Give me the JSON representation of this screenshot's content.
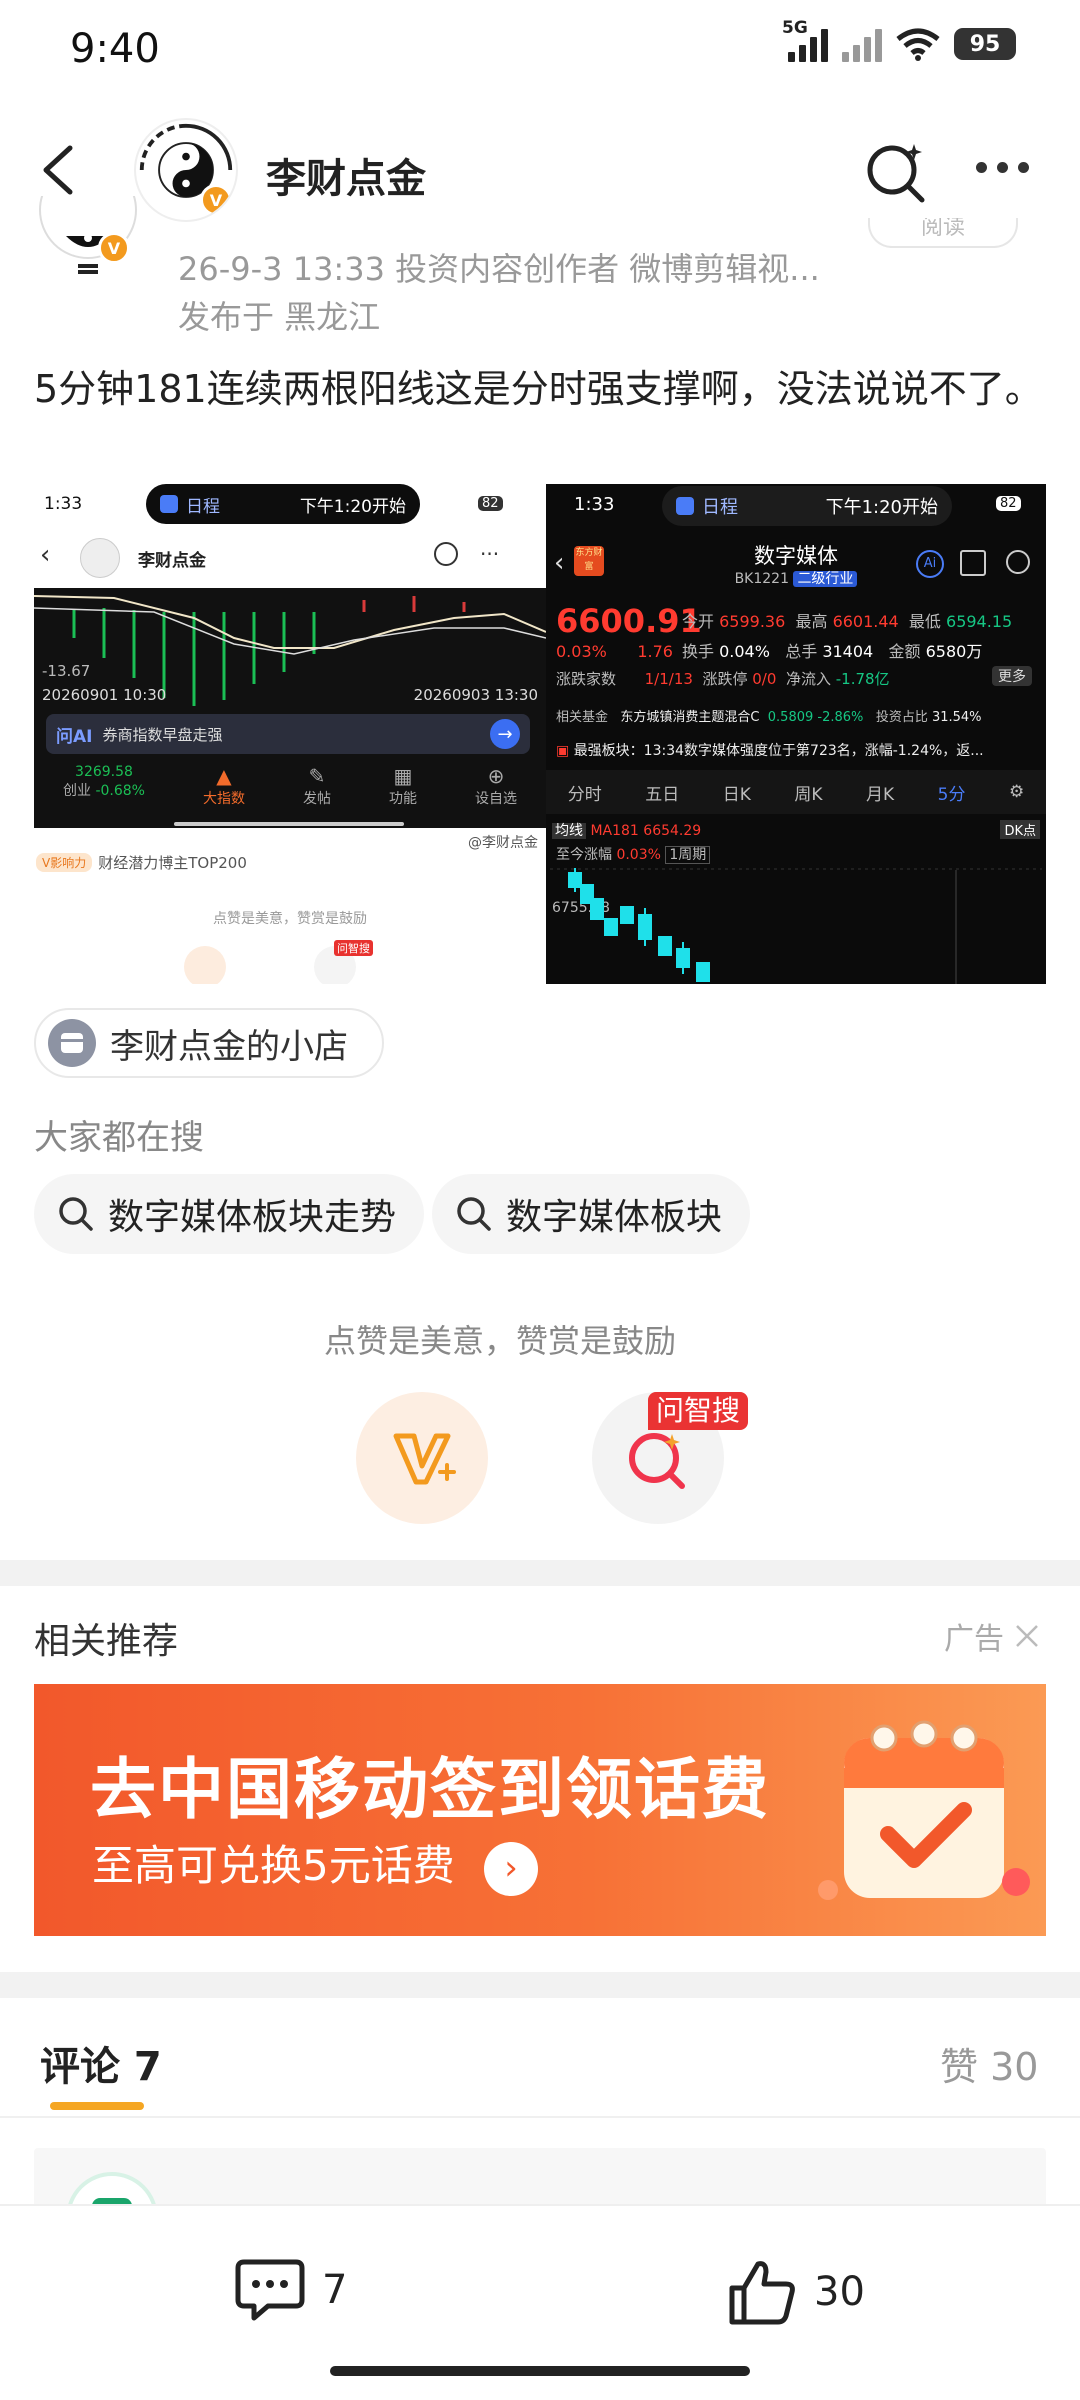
{
  "status_bar": {
    "time": "9:40",
    "network": "5G",
    "battery": "95"
  },
  "header": {
    "title": "李财点金"
  },
  "post": {
    "meta": "26-9-3 13:33   投资内容创作者 微博剪辑视...",
    "location": "发布于 黑龙江",
    "read_chip": "阅读",
    "text": "5分钟181连续两根阳线这是分时强支撑啊，没法说说不了。"
  },
  "image1": {
    "time": "1:33",
    "pill_app": "日程",
    "pill_text": "下午1:20开始",
    "wifi_level": "82",
    "nav_title": "李财点金",
    "chart_low": "-13.67",
    "date_left": "20260901 10:30",
    "date_right": "20260903 13:30",
    "ai_label": "问AI",
    "ai_text": "券商指数早盘走强",
    "tab_value": "3269.58",
    "tab1_label": "创业",
    "tab1_change": "-0.68%",
    "tab2_label": "大指数",
    "tab3_label": "发帖",
    "tab4_label": "功能",
    "tab5_label": "设自选",
    "watermark": "@李财点金",
    "badge_label": "V影响力",
    "badge_text": "财经潜力博主TOP200",
    "reward_hint": "点赞是美意，赞赏是鼓励",
    "search_tag": "问智搜"
  },
  "image2": {
    "time": "1:33",
    "pill_app": "日程",
    "pill_text": "下午1:20开始",
    "wifi_level": "82",
    "badge": "东方财富",
    "title": "数字媒体",
    "code": "BK1221",
    "industry": "二级行业",
    "ai": "Ai",
    "price": "6600.91",
    "change_pct": "0.03%",
    "change_abs": "1.76",
    "open_label": "今开",
    "open": "6599.36",
    "high_label": "最高",
    "high": "6601.44",
    "low_label": "最低",
    "low": "6594.15",
    "turnover_label": "换手",
    "turnover": "0.04%",
    "total_label": "总手",
    "total": "31404",
    "amount_label": "金额",
    "amount": "6580万",
    "updown_label": "涨跌家数",
    "updown": "1/1/13",
    "limit_label": "涨跌停",
    "limit": "0/0",
    "inflow_label": "净流入",
    "inflow": "-1.78亿",
    "more": "更多",
    "fund_label": "相关基金",
    "fund_name": "东方城镇消费主题混合C",
    "fund_val": "0.5809",
    "fund_chg": "-2.86%",
    "invest_label": "投资占比",
    "invest_val": "31.54%",
    "alert_text": "最强板块：13:34数字媒体强度位于第723名，涨幅-1.24%，返...",
    "tabs": [
      "分时",
      "五日",
      "日K",
      "周K",
      "月K",
      "5分"
    ],
    "ma_label": "均线",
    "ma_value": "MA181 6654.29",
    "dk_label": "DK点",
    "since_label": "至今涨幅",
    "since_val": "0.03%",
    "period": "1周期",
    "axis_value": "6755.28"
  },
  "store": {
    "label": "李财点金的小店"
  },
  "trending": {
    "title": "大家都在搜",
    "chips": [
      "数字媒体板块走势",
      "数字媒体板块"
    ]
  },
  "reward": {
    "hint": "点赞是美意，赞赏是鼓励",
    "search_tag": "问智搜"
  },
  "recommend": {
    "title": "相关推荐",
    "ad_label": "广告",
    "banner_title": "去中国移动签到领话费",
    "banner_sub": "至高可兑换5元话费"
  },
  "comments": {
    "label": "评论 7",
    "likes_label": "赞 30"
  },
  "bottom_bar": {
    "comment_count": "7",
    "like_count": "30"
  },
  "colors": {
    "accent": "#f5a623",
    "weibo_orange": "#f39a1e",
    "banner": "#f2582b",
    "up_red": "#ff3b30",
    "down_green": "#16c784",
    "candle_cyan": "#1fe0ea"
  }
}
